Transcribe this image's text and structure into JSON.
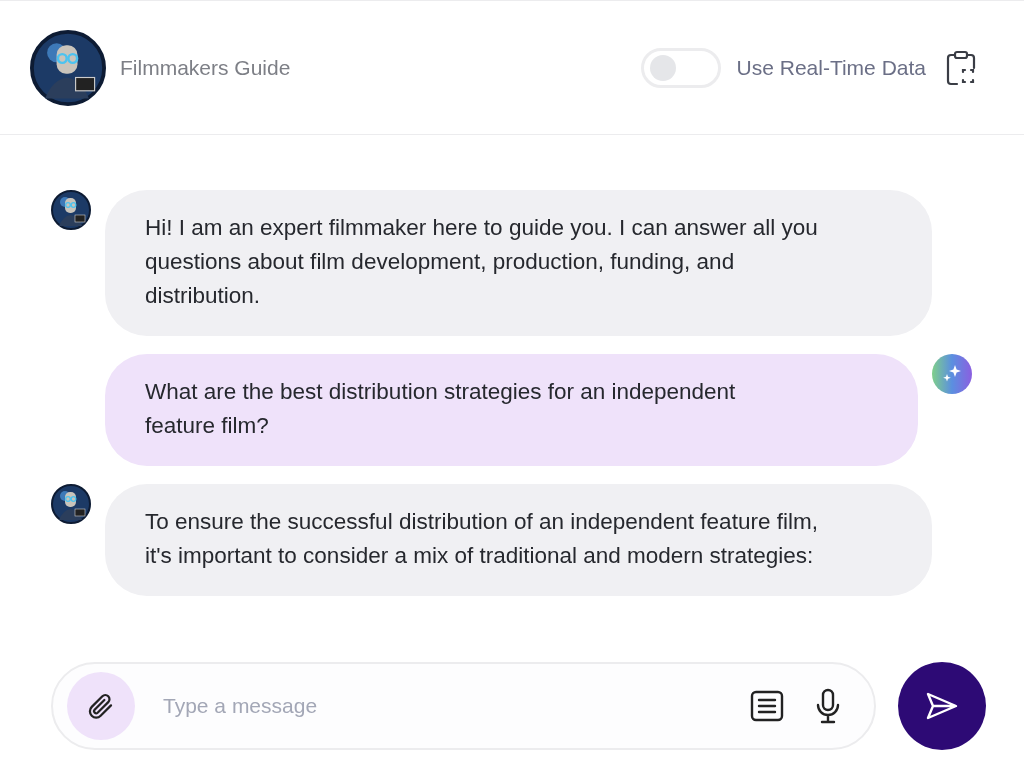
{
  "header": {
    "title": "Filmmakers Guide",
    "toggle": {
      "label": "Use Real-Time Data",
      "on": false
    }
  },
  "messages": [
    {
      "kind": "bot",
      "text": "Hi! I am an expert filmmaker here to guide you. I can answer all you questions about film development, production, funding, and distribution."
    },
    {
      "kind": "user",
      "text": "What are the best distribution strategies for an independent feature film?"
    },
    {
      "kind": "bot",
      "text": "To ensure the successful distribution of an independent feature film, it's important to consider a mix of traditional and modern strategies:"
    }
  ],
  "composer": {
    "placeholder": "Type a message"
  }
}
